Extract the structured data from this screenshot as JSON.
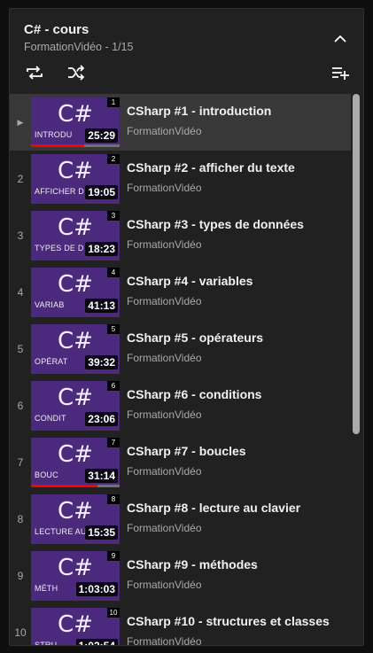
{
  "playlist": {
    "title": "C# - cours",
    "subtitle": "FormationVidéo - 1/15"
  },
  "icons": {
    "collapse": "chevron-up-icon",
    "loop": "loop-icon",
    "shuffle": "shuffle-icon",
    "add": "add-to-queue-icon",
    "playing": "play-icon"
  },
  "colors": {
    "thumbnail": "#4b2a7d",
    "progress": "#ff0000"
  },
  "videos": [
    {
      "index": "▶",
      "num": "1",
      "thumb_text": "C#",
      "caption": "INTRODU",
      "duration": "25:29",
      "title": "CSharp #1 - introduction",
      "channel": "FormationVidéo",
      "watched": 0.6,
      "active": true
    },
    {
      "index": "2",
      "num": "2",
      "thumb_text": "C#",
      "caption": "AFFICHER D",
      "duration": "19:05",
      "title": "CSharp #2 - afficher du texte",
      "channel": "FormationVidéo",
      "watched": 0
    },
    {
      "index": "3",
      "num": "3",
      "thumb_text": "C#",
      "caption": "TYPES DE D",
      "duration": "18:23",
      "title": "CSharp #3 - types de données",
      "channel": "FormationVidéo",
      "watched": 0
    },
    {
      "index": "4",
      "num": "4",
      "thumb_text": "C#",
      "caption": "VARIAB",
      "duration": "41:13",
      "title": "CSharp #4 - variables",
      "channel": "FormationVidéo",
      "watched": 0
    },
    {
      "index": "5",
      "num": "5",
      "thumb_text": "C#",
      "caption": "OPÉRAT",
      "duration": "39:32",
      "title": "CSharp #5 - opérateurs",
      "channel": "FormationVidéo",
      "watched": 0
    },
    {
      "index": "6",
      "num": "6",
      "thumb_text": "C#",
      "caption": "CONDIT",
      "duration": "23:06",
      "title": "CSharp #6 - conditions",
      "channel": "FormationVidéo",
      "watched": 0
    },
    {
      "index": "7",
      "num": "7",
      "thumb_text": "C#",
      "caption": "BOUC",
      "duration": "31:14",
      "title": "CSharp #7 - boucles",
      "channel": "FormationVidéo",
      "watched": 0.75
    },
    {
      "index": "8",
      "num": "8",
      "thumb_text": "C#",
      "caption": "LECTURE AU",
      "duration": "15:35",
      "title": "CSharp #8 - lecture au clavier",
      "channel": "FormationVidéo",
      "watched": 0
    },
    {
      "index": "9",
      "num": "9",
      "thumb_text": "C#",
      "caption": "MÉTH",
      "duration": "1:03:03",
      "title": "CSharp #9 - méthodes",
      "channel": "FormationVidéo",
      "watched": 0
    },
    {
      "index": "10",
      "num": "10",
      "thumb_text": "C#",
      "caption": "STRU",
      "duration": "1:02:54",
      "title": "CSharp #10 - structures et classes",
      "channel": "FormationVidéo",
      "watched": 0
    }
  ]
}
